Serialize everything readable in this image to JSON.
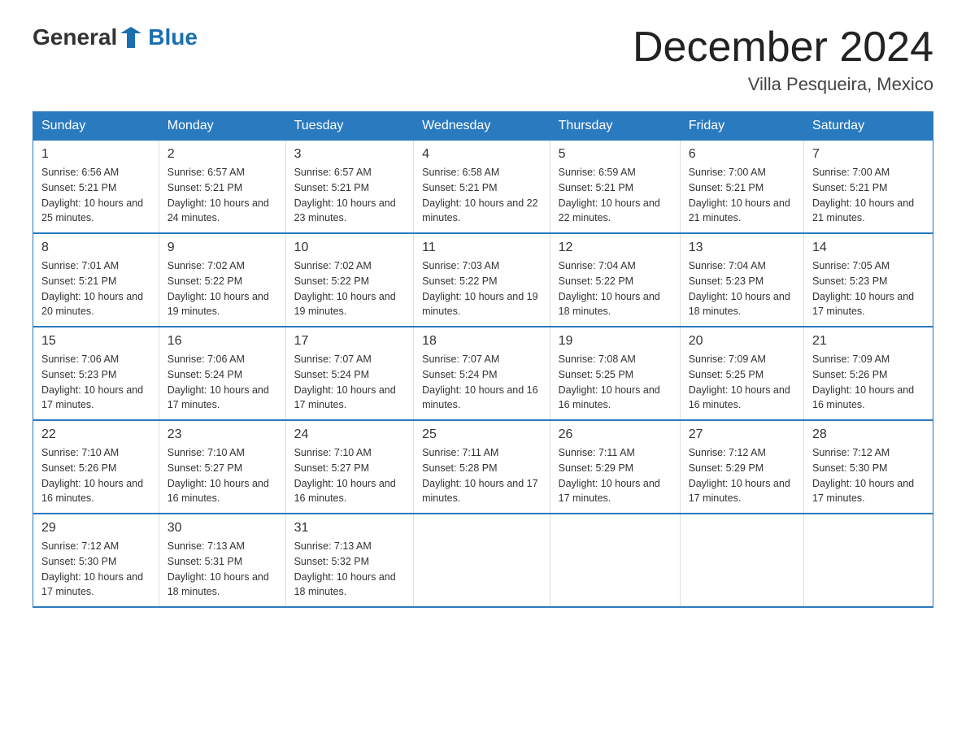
{
  "logo": {
    "general": "General",
    "blue": "Blue"
  },
  "title": "December 2024",
  "location": "Villa Pesqueira, Mexico",
  "days_of_week": [
    "Sunday",
    "Monday",
    "Tuesday",
    "Wednesday",
    "Thursday",
    "Friday",
    "Saturday"
  ],
  "weeks": [
    [
      {
        "day": "1",
        "sunrise": "6:56 AM",
        "sunset": "5:21 PM",
        "daylight": "10 hours and 25 minutes."
      },
      {
        "day": "2",
        "sunrise": "6:57 AM",
        "sunset": "5:21 PM",
        "daylight": "10 hours and 24 minutes."
      },
      {
        "day": "3",
        "sunrise": "6:57 AM",
        "sunset": "5:21 PM",
        "daylight": "10 hours and 23 minutes."
      },
      {
        "day": "4",
        "sunrise": "6:58 AM",
        "sunset": "5:21 PM",
        "daylight": "10 hours and 22 minutes."
      },
      {
        "day": "5",
        "sunrise": "6:59 AM",
        "sunset": "5:21 PM",
        "daylight": "10 hours and 22 minutes."
      },
      {
        "day": "6",
        "sunrise": "7:00 AM",
        "sunset": "5:21 PM",
        "daylight": "10 hours and 21 minutes."
      },
      {
        "day": "7",
        "sunrise": "7:00 AM",
        "sunset": "5:21 PM",
        "daylight": "10 hours and 21 minutes."
      }
    ],
    [
      {
        "day": "8",
        "sunrise": "7:01 AM",
        "sunset": "5:21 PM",
        "daylight": "10 hours and 20 minutes."
      },
      {
        "day": "9",
        "sunrise": "7:02 AM",
        "sunset": "5:22 PM",
        "daylight": "10 hours and 19 minutes."
      },
      {
        "day": "10",
        "sunrise": "7:02 AM",
        "sunset": "5:22 PM",
        "daylight": "10 hours and 19 minutes."
      },
      {
        "day": "11",
        "sunrise": "7:03 AM",
        "sunset": "5:22 PM",
        "daylight": "10 hours and 19 minutes."
      },
      {
        "day": "12",
        "sunrise": "7:04 AM",
        "sunset": "5:22 PM",
        "daylight": "10 hours and 18 minutes."
      },
      {
        "day": "13",
        "sunrise": "7:04 AM",
        "sunset": "5:23 PM",
        "daylight": "10 hours and 18 minutes."
      },
      {
        "day": "14",
        "sunrise": "7:05 AM",
        "sunset": "5:23 PM",
        "daylight": "10 hours and 17 minutes."
      }
    ],
    [
      {
        "day": "15",
        "sunrise": "7:06 AM",
        "sunset": "5:23 PM",
        "daylight": "10 hours and 17 minutes."
      },
      {
        "day": "16",
        "sunrise": "7:06 AM",
        "sunset": "5:24 PM",
        "daylight": "10 hours and 17 minutes."
      },
      {
        "day": "17",
        "sunrise": "7:07 AM",
        "sunset": "5:24 PM",
        "daylight": "10 hours and 17 minutes."
      },
      {
        "day": "18",
        "sunrise": "7:07 AM",
        "sunset": "5:24 PM",
        "daylight": "10 hours and 16 minutes."
      },
      {
        "day": "19",
        "sunrise": "7:08 AM",
        "sunset": "5:25 PM",
        "daylight": "10 hours and 16 minutes."
      },
      {
        "day": "20",
        "sunrise": "7:09 AM",
        "sunset": "5:25 PM",
        "daylight": "10 hours and 16 minutes."
      },
      {
        "day": "21",
        "sunrise": "7:09 AM",
        "sunset": "5:26 PM",
        "daylight": "10 hours and 16 minutes."
      }
    ],
    [
      {
        "day": "22",
        "sunrise": "7:10 AM",
        "sunset": "5:26 PM",
        "daylight": "10 hours and 16 minutes."
      },
      {
        "day": "23",
        "sunrise": "7:10 AM",
        "sunset": "5:27 PM",
        "daylight": "10 hours and 16 minutes."
      },
      {
        "day": "24",
        "sunrise": "7:10 AM",
        "sunset": "5:27 PM",
        "daylight": "10 hours and 16 minutes."
      },
      {
        "day": "25",
        "sunrise": "7:11 AM",
        "sunset": "5:28 PM",
        "daylight": "10 hours and 17 minutes."
      },
      {
        "day": "26",
        "sunrise": "7:11 AM",
        "sunset": "5:29 PM",
        "daylight": "10 hours and 17 minutes."
      },
      {
        "day": "27",
        "sunrise": "7:12 AM",
        "sunset": "5:29 PM",
        "daylight": "10 hours and 17 minutes."
      },
      {
        "day": "28",
        "sunrise": "7:12 AM",
        "sunset": "5:30 PM",
        "daylight": "10 hours and 17 minutes."
      }
    ],
    [
      {
        "day": "29",
        "sunrise": "7:12 AM",
        "sunset": "5:30 PM",
        "daylight": "10 hours and 17 minutes."
      },
      {
        "day": "30",
        "sunrise": "7:13 AM",
        "sunset": "5:31 PM",
        "daylight": "10 hours and 18 minutes."
      },
      {
        "day": "31",
        "sunrise": "7:13 AM",
        "sunset": "5:32 PM",
        "daylight": "10 hours and 18 minutes."
      },
      null,
      null,
      null,
      null
    ]
  ]
}
